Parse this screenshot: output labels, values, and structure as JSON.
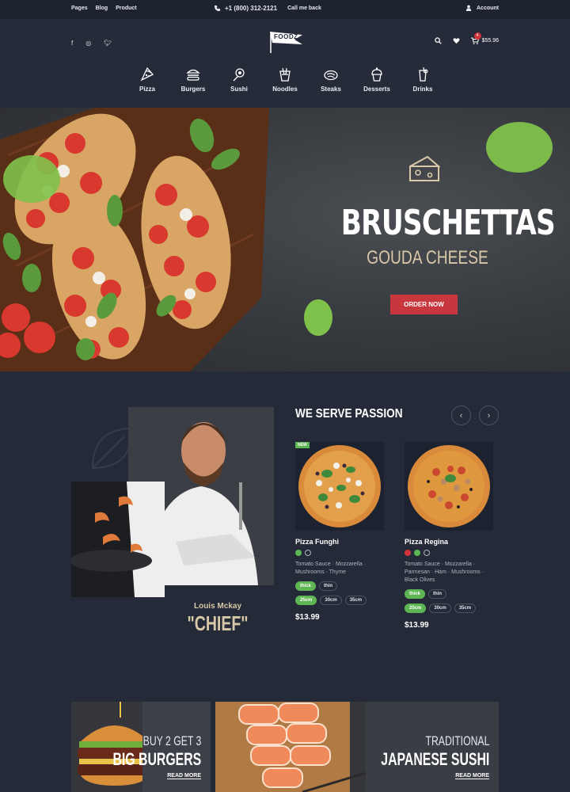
{
  "topbar": {
    "links": [
      "Pages",
      "Blog",
      "Product"
    ],
    "phone": "+1 (800) 312-2121",
    "callback": "Call me back",
    "account": "Account"
  },
  "header": {
    "logo": "FOODZ",
    "cart_count": "4",
    "cart_total": "$55.96"
  },
  "menu": [
    {
      "label": "Pizza",
      "icon": "pizza-icon"
    },
    {
      "label": "Burgers",
      "icon": "burger-icon"
    },
    {
      "label": "Sushi",
      "icon": "sushi-icon"
    },
    {
      "label": "Noodles",
      "icon": "noodles-icon"
    },
    {
      "label": "Steaks",
      "icon": "steak-icon"
    },
    {
      "label": "Desserts",
      "icon": "dessert-icon"
    },
    {
      "label": "Drinks",
      "icon": "drink-icon"
    }
  ],
  "hero": {
    "title": "BRUSCHETTAS",
    "subtitle": "GOUDA CHEESE",
    "button": "ORDER NOW"
  },
  "chef": {
    "name": "Louis Mckay",
    "role": "\"CHIEF\""
  },
  "section": {
    "title": "WE SERVE PASSION",
    "prev": "‹",
    "next": "›"
  },
  "products": [
    {
      "badge": "NEW",
      "name": "Pizza Funghi",
      "desc": "Tomato Sauce · Mozzarella · Mushrooms · Thyme",
      "crust": [
        "thick",
        "thin"
      ],
      "sizes": [
        "25cm",
        "30cm",
        "35cm"
      ],
      "price": "$13.99"
    },
    {
      "badge": "",
      "name": "Pizza Regina",
      "desc": "Tomato Sauce · Mozzarella · Parmesan · Ham · Mushrooms · Black Olives",
      "crust": [
        "thick",
        "thin"
      ],
      "sizes": [
        "25cm",
        "30cm",
        "35cm"
      ],
      "price": "$13.99"
    }
  ],
  "banners": [
    {
      "pre": "BUY 2 GET 3",
      "main": "BIG BURGERS",
      "link": "READ MORE"
    },
    {
      "pre": "TRADITIONAL",
      "main": "JAPANESE SUSHI",
      "link": "READ MORE"
    }
  ],
  "colors": {
    "accent": "#c8373e",
    "green": "#5db653",
    "background": "#242a37",
    "gold": "#d6c7a8"
  }
}
